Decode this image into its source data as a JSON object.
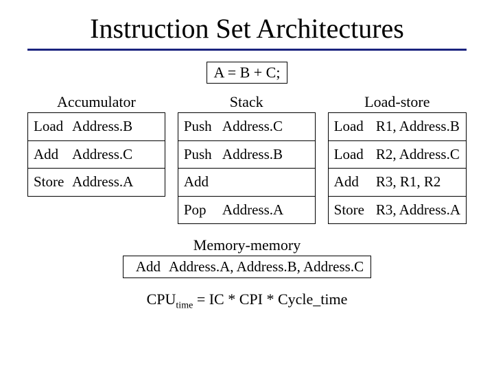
{
  "title": "Instruction Set Architectures",
  "expression": "A = B + C;",
  "columns": {
    "accumulator": {
      "title": "Accumulator",
      "rows": [
        {
          "op": "Load",
          "args": "Address.B"
        },
        {
          "op": "Add",
          "args": "Address.C"
        },
        {
          "op": "Store",
          "args": "Address.A"
        }
      ]
    },
    "stack": {
      "title": "Stack",
      "rows": [
        {
          "op": "Push",
          "args": "Address.C"
        },
        {
          "op": "Push",
          "args": "Address.B"
        },
        {
          "op": "Add",
          "args": ""
        },
        {
          "op": "Pop",
          "args": "Address.A"
        }
      ]
    },
    "loadstore": {
      "title": "Load-store",
      "rows": [
        {
          "op": "Load",
          "args": "R1, Address.B"
        },
        {
          "op": "Load",
          "args": "R2, Address.C"
        },
        {
          "op": "Add",
          "args": "R3, R1, R2"
        },
        {
          "op": "Store",
          "args": "R3, Address.A"
        }
      ]
    }
  },
  "memory_memory": {
    "title": "Memory-memory",
    "op": "Add",
    "args": "Address.A, Address.B, Address.C"
  },
  "formula": {
    "lhs_base": "CPU",
    "lhs_sub": "time",
    "rhs": " = IC * CPI * Cycle_time"
  }
}
